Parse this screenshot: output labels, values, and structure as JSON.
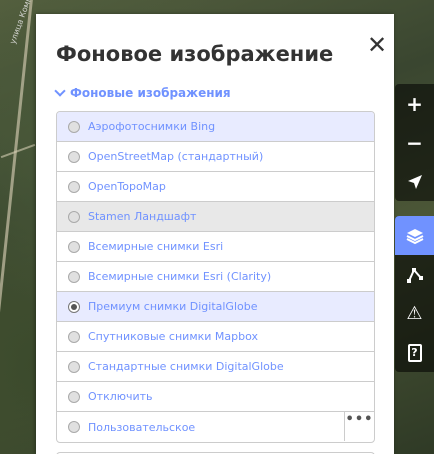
{
  "map": {
    "street_label": "улица Комм"
  },
  "panel": {
    "title": "Фоновое изображение",
    "close_glyph": "✕",
    "section_title": "Фоновые изображения",
    "items": [
      {
        "label": "Аэрофотоснимки Bing",
        "selected": false,
        "highlight": "blue"
      },
      {
        "label": "OpenStreetMap (стандартный)",
        "selected": false,
        "highlight": "none"
      },
      {
        "label": "OpenTopoMap",
        "selected": false,
        "highlight": "none"
      },
      {
        "label": "Stamen Ландшафт",
        "selected": false,
        "highlight": "grey"
      },
      {
        "label": "Всемирные снимки Esri",
        "selected": false,
        "highlight": "none"
      },
      {
        "label": "Всемирные снимки Esri (Clarity)",
        "selected": false,
        "highlight": "none"
      },
      {
        "label": "Премиум снимки DigitalGlobe",
        "selected": true,
        "highlight": "blue"
      },
      {
        "label": "Спутниковые снимки Mapbox",
        "selected": false,
        "highlight": "none"
      },
      {
        "label": "Стандартные снимки DigitalGlobe",
        "selected": false,
        "highlight": "none"
      },
      {
        "label": "Отключить",
        "selected": false,
        "highlight": "none"
      },
      {
        "label": "Пользовательское",
        "selected": false,
        "highlight": "none",
        "more": "•••"
      }
    ]
  },
  "toolbar": {
    "zoom_in": "+",
    "zoom_out": "−",
    "locate": "➤",
    "background": "layers-icon",
    "map_data": "map-data-icon",
    "issues": "⚠",
    "help": "?"
  },
  "colors": {
    "accent": "#7092ff",
    "selected_bg": "#e8ebff",
    "grey_bg": "#e8e8e8"
  }
}
